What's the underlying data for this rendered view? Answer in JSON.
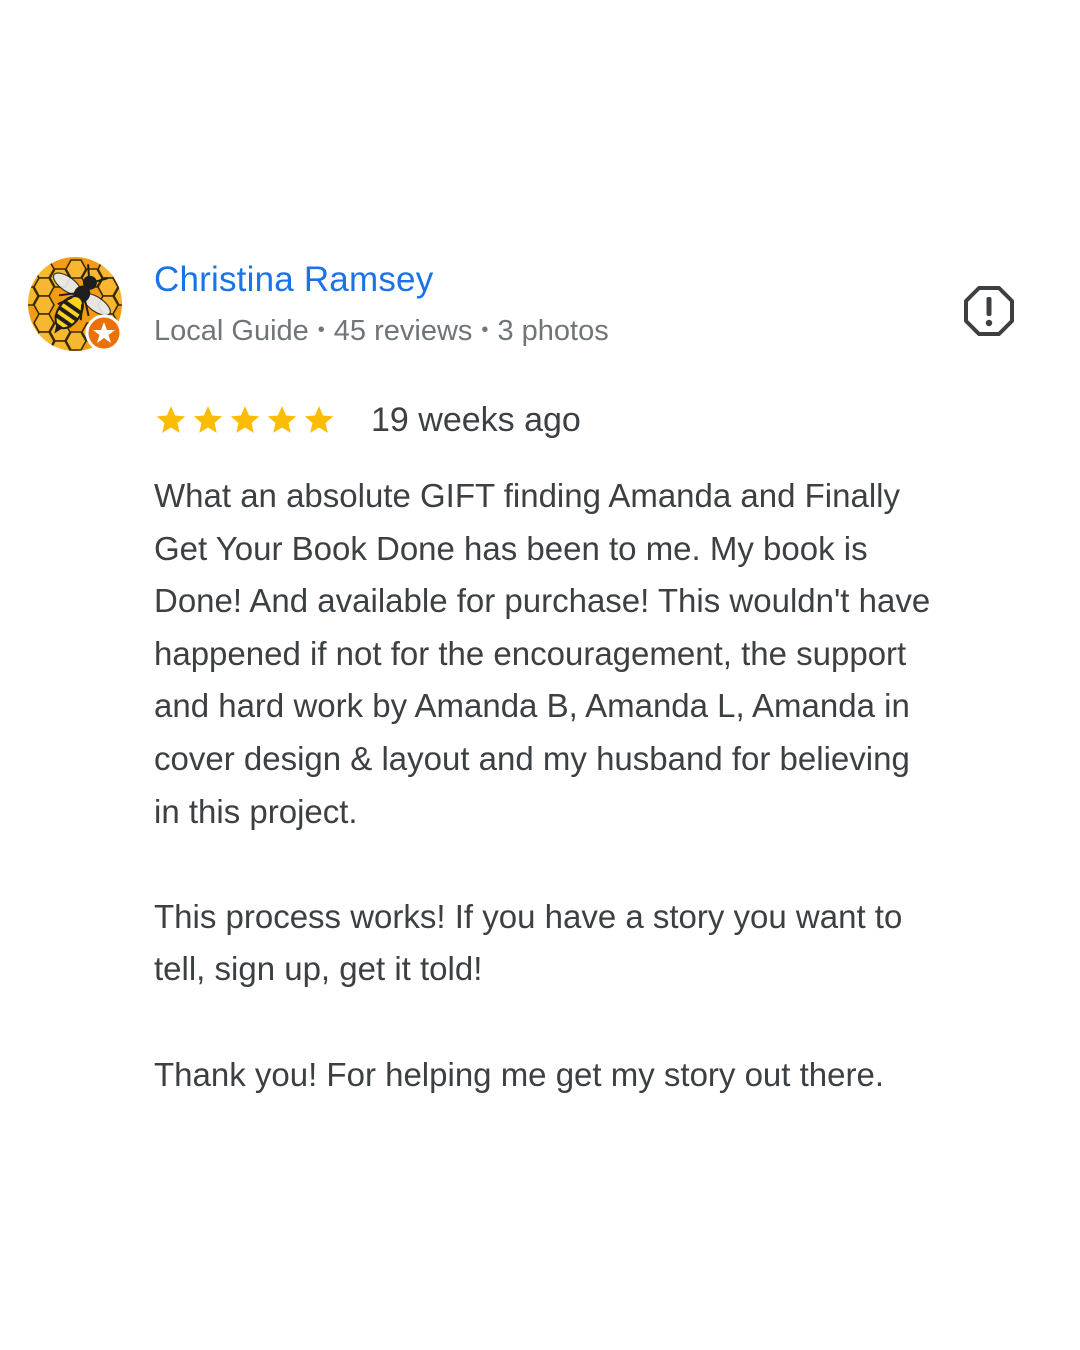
{
  "review": {
    "author": {
      "name": "Christina Ramsey",
      "role": "Local Guide",
      "reviews_count": "45 reviews",
      "photos_count": "3 photos",
      "separator": "•",
      "avatar_icon": "wasp-honeycomb-avatar",
      "badge_icon": "local-guide-star-badge"
    },
    "rating": {
      "stars": 5,
      "max": 5,
      "timestamp": "19 weeks ago",
      "star_color": "#fbbc04"
    },
    "report_icon": "report-flag-icon",
    "body": {
      "paragraph1": "What an absolute GIFT finding Amanda and Finally\nGet Your Book Done has been to me. My book is\nDone! And available for purchase! This wouldn't have\nhappened if not for the encouragement, the support\nand hard work by Amanda B, Amanda L, Amanda in\ncover design & layout and my husband for believing\nin this project.",
      "paragraph2": "This process works! If you have a story you want to\ntell, sign up, get it told!",
      "paragraph3": "Thank you! For helping me get my story out there."
    },
    "colors": {
      "name": "#1a73e8",
      "meta": "#70757a",
      "text": "#3c4043",
      "badge": "#e8710a"
    }
  }
}
